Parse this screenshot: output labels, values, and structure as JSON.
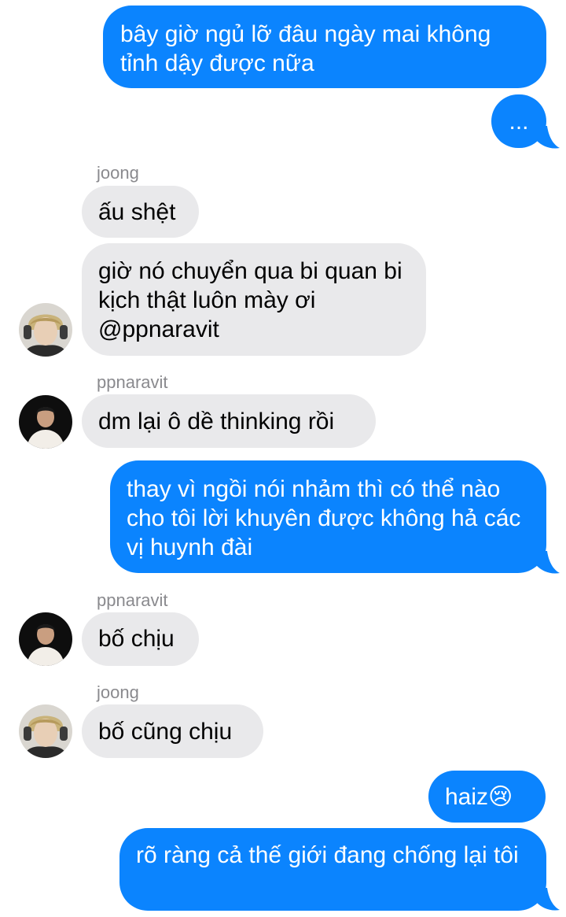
{
  "colors": {
    "outgoing_bubble": "#0b84fe",
    "incoming_bubble": "#e9e9eb",
    "sender_name": "#8a8a8e"
  },
  "messages": [
    {
      "id": "m1",
      "direction": "outgoing",
      "text": "bây giờ ngủ lỡ đâu ngày mai không tỉnh dậy được nữa"
    },
    {
      "id": "m2",
      "direction": "outgoing",
      "text": "..."
    },
    {
      "id": "m3",
      "direction": "incoming",
      "sender": "joong",
      "text": "ấu shệt"
    },
    {
      "id": "m4",
      "direction": "incoming",
      "sender": "joong",
      "text": "giờ nó chuyển qua bi quan bi kịch thật luôn mày ơi @ppnaravit",
      "avatar": "avatar-joong"
    },
    {
      "id": "m5",
      "direction": "incoming",
      "sender": "ppnaravit",
      "text": "dm lại ô dề thinking rồi",
      "avatar": "avatar-ppnaravit"
    },
    {
      "id": "m6",
      "direction": "outgoing",
      "text": "thay vì ngồi nói nhảm thì có thể nào cho tôi lời khuyên được không hả các vị huynh đài"
    },
    {
      "id": "m7",
      "direction": "incoming",
      "sender": "ppnaravit",
      "text": "bố chịu",
      "avatar": "avatar-ppnaravit"
    },
    {
      "id": "m8",
      "direction": "incoming",
      "sender": "joong",
      "text": "bố cũng chịu",
      "avatar": "avatar-joong"
    },
    {
      "id": "m9",
      "direction": "outgoing",
      "text": "haiz",
      "emoji": "😢"
    },
    {
      "id": "m10",
      "direction": "outgoing",
      "text": "rõ ràng cả thế giới đang chống lại tôi"
    }
  ]
}
